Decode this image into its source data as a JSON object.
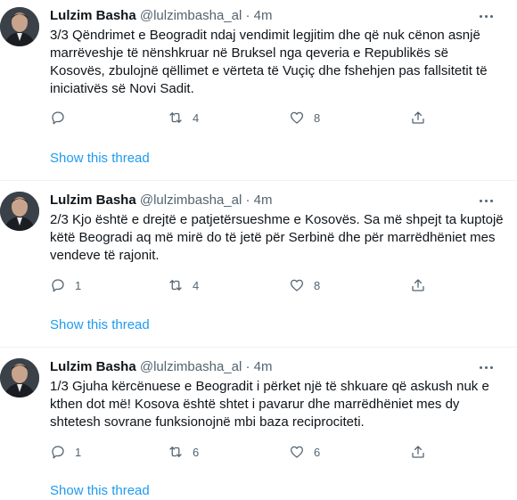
{
  "tweets": [
    {
      "name": "Lulzim Basha",
      "handle": "@lulzimbasha_al",
      "separator": "·",
      "time": "4m",
      "text": "3/3 Qëndrimet e Beogradit ndaj vendimit legjitim dhe që nuk cënon asnjë marrëveshje të nënshkruar në Bruksel nga qeveria e Republikës së Kosovës, zbulojnë qëllimet e vërteta të Vuçiç dhe fshehjen pas fallsitetit të iniciativës së Novi Sadit.",
      "replies": "",
      "retweets": "4",
      "likes": "8",
      "show_thread": "Show this thread"
    },
    {
      "name": "Lulzim Basha",
      "handle": "@lulzimbasha_al",
      "separator": "·",
      "time": "4m",
      "text": "2/3 Kjo është e drejtë e patjetërsueshme e Kosovës. Sa më shpejt ta kuptojë këtë Beogradi aq më mirë do të jetë për Serbinë dhe për marrëdhëniet mes vendeve të rajonit.",
      "replies": "1",
      "retweets": "4",
      "likes": "8",
      "show_thread": "Show this thread"
    },
    {
      "name": "Lulzim Basha",
      "handle": "@lulzimbasha_al",
      "separator": "·",
      "time": "4m",
      "text": "1/3 Gjuha kërcënuese e Beogradit i përket një të shkuare që askush nuk e kthen dot më! Kosova është shtet i pavarur dhe marrëdhëniet mes dy shtetesh sovrane funksionojnë mbi baza reciprociteti.",
      "replies": "1",
      "retweets": "6",
      "likes": "6",
      "show_thread": "Show this thread"
    }
  ],
  "icons": {
    "reply": "reply-icon",
    "retweet": "retweet-icon",
    "like": "like-icon",
    "share": "share-icon",
    "more": "more-icon"
  },
  "colors": {
    "text": "#0f1419",
    "secondary": "#536471",
    "link": "#1d9bf0",
    "divider": "#eff3f4"
  }
}
